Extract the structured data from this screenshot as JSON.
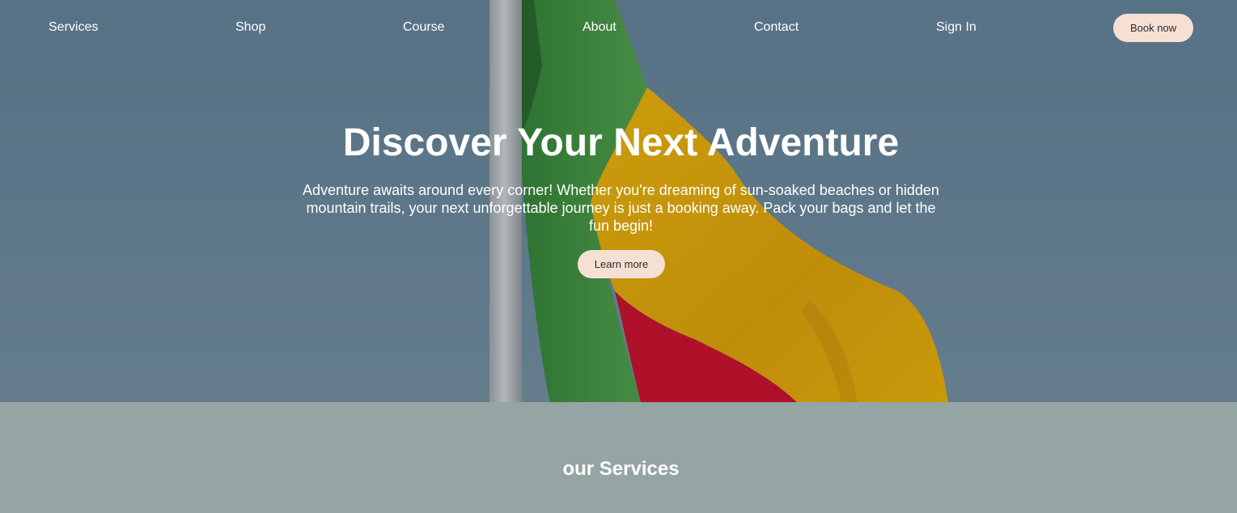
{
  "nav": {
    "items": [
      {
        "label": "Services"
      },
      {
        "label": "Shop"
      },
      {
        "label": "Course"
      },
      {
        "label": "About"
      },
      {
        "label": "Contact"
      },
      {
        "label": "Sign In"
      }
    ],
    "book_label": "Book now"
  },
  "hero": {
    "title": "Discover Your Next Adventure",
    "text": "Adventure awaits around every corner! Whether you're dreaming of sun-soaked beaches or hidden mountain trails, your next unforgettable journey is just a booking away. Pack your bags and let the fun begin!",
    "button_label": "Learn more",
    "background_image": "flag-on-pole-photo"
  },
  "services": {
    "title": "our Services"
  },
  "colors": {
    "sky": "#647f92",
    "button_bg": "#f6e0d4",
    "services_bg": "#95a5a4",
    "flag_green": "#3d8a3a",
    "flag_yellow": "#e0a800",
    "flag_red": "#c2001c",
    "text": "#ffffff"
  }
}
